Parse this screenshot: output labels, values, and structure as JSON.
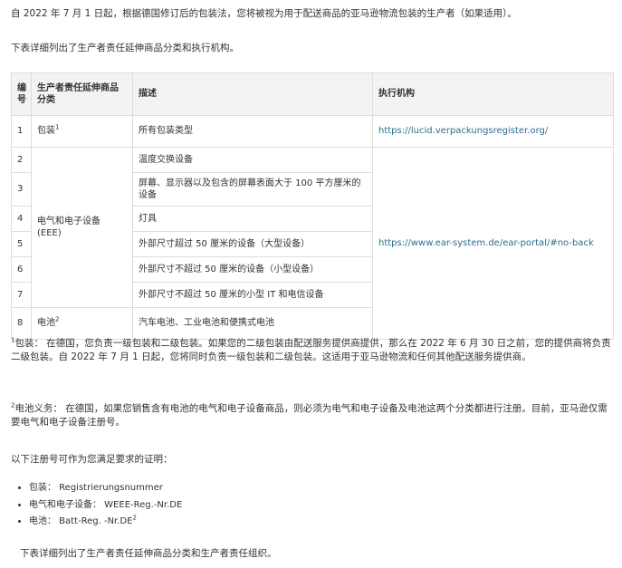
{
  "intro": {
    "p1": "自 2022 年 7 月 1 日起，根据德国修订后的包装法，您将被视为用于配送商品的亚马逊物流包装的生产者（如果适用）。",
    "p2": "下表详细列出了生产者责任延伸商品分类和执行机构。"
  },
  "table": {
    "headers": {
      "no": "编号",
      "category": "生产者责任延伸商品分类",
      "description": "描述",
      "agency": "执行机构"
    },
    "rows": [
      {
        "no": "1",
        "category": "包装",
        "category_sup": "1",
        "description": "所有包装类型",
        "agency": "https://lucid.verpackungsregister.org/"
      },
      {
        "no": "2",
        "description": "温度交换设备"
      },
      {
        "no": "3",
        "description": "屏幕、显示器以及包含的屏幕表面大于 100 平方厘米的设备"
      },
      {
        "no": "4",
        "description": "灯具"
      },
      {
        "no": "5",
        "description": "外部尺寸超过 50 厘米的设备（大型设备）"
      },
      {
        "no": "6",
        "description": "外部尺寸不超过 50 厘米的设备（小型设备）"
      },
      {
        "no": "7",
        "description": "外部尺寸不超过 50 厘米的小型 IT 和电信设备"
      },
      {
        "no": "8",
        "category": "电池",
        "category_sup": "2",
        "description": "汽车电池、工业电池和便携式电池"
      }
    ],
    "eee_category": "电气和电子设备 (EEE)",
    "eee_agency": "https://www.ear-system.de/ear-portal/#no-back"
  },
  "footnotes": {
    "fn1_mark": "1",
    "fn1": "包装： 在德国，您负责一级包装和二级包装。如果您的二级包装由配送服务提供商提供，那么在 2022 年 6 月 30 日之前，您的提供商将负责二级包装。自 2022 年 7 月 1 日起，您将同时负责一级包装和二级包装。这适用于亚马逊物流和任何其他配送服务提供商。",
    "fn2_mark": "2",
    "fn2": "电池义务： 在德国，如果您销售含有电池的电气和电子设备商品，则必须为电气和电子设备及电池这两个分类都进行注册。目前，亚马逊仅需要电气和电子设备注册号。"
  },
  "proof": {
    "intro": "以下注册号可作为您满足要求的证明：",
    "items": [
      {
        "text": "包装： Registrierungsnummer"
      },
      {
        "text": "电气和电子设备： WEEE-Reg.-Nr.DE"
      },
      {
        "text": "电池： Batt-Reg. -Nr.DE",
        "sup": "2"
      }
    ]
  },
  "closing": "下表详细列出了生产者责任延伸商品分类和生产者责任组织。"
}
